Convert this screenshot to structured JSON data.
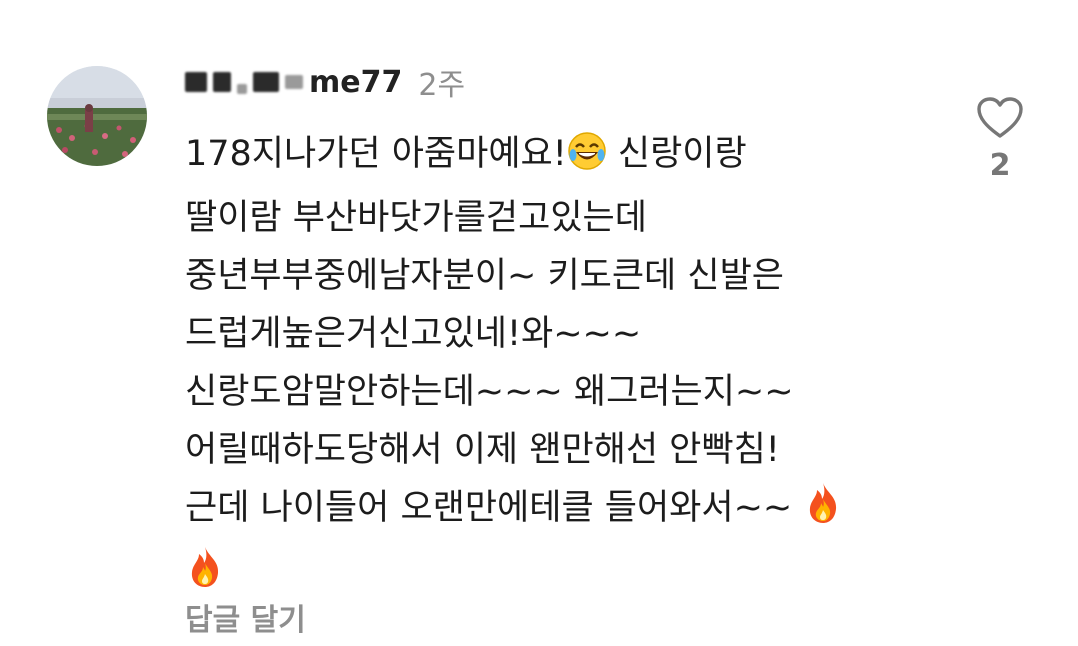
{
  "comment": {
    "username_visible": "me77",
    "time_ago": "2주",
    "lines": [
      "178지나가던 아줌마예요!",
      "신랑이랑",
      "딸이람 부산바닷가를걷고있는데",
      "중년부부중에남자분이~ 키도큰데 신발은",
      "드럽게높은거신고있네!와~~~",
      "신랑도암말안하는데~~~ 왜그러는지~~",
      "어릴때하도당해서 이제 왠만해선 안빡침!",
      "근데 나이들어 오랜만에테클 들어와서~~"
    ],
    "emoji_laugh": "face-with-tears-of-joy",
    "emoji_fire": "fire",
    "reply_label": "답글 달기",
    "like_count": "2"
  },
  "icons": {
    "like": "heart-outline-icon",
    "avatar": "profile-photo-field"
  }
}
